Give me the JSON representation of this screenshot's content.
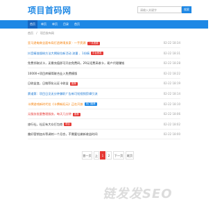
{
  "header": {
    "logo": "项目首码网",
    "search_placeholder": "请输入关键字",
    "search_button": "搜索"
  },
  "nav": [
    "首页",
    "单页",
    "单页",
    "目录",
    "首页"
  ],
  "breadcrumb": [
    "首页",
    "项目发布网"
  ],
  "rows": [
    {
      "title": "亚马逊电商全面布局打造跨境卖家 · 一手资源",
      "color": "#f57c00",
      "badge": "一手资源",
      "badge_color": "#e53935",
      "date": "02-22 18:34"
    },
    {
      "title": "抖音精准搜粉方法大揭秘拉新活动 流量 、1份搞",
      "color": "#1976d2",
      "badge": "平台首发",
      "badge_color": "#e53935",
      "date": "02-22 18:31"
    },
    {
      "title": "免费领取试卡，无需充值即可开启免费码，29元话费高收卡，易户代理赚钱",
      "color": "#333333",
      "badge": "",
      "badge_color": "",
      "date": "02-22 18:28"
    },
    {
      "title": "10000+项目库精简联合业入免费模版",
      "color": "#333333",
      "badge": "",
      "badge_color": "",
      "date": "02-22 18:22"
    },
    {
      "title": "日收益变，日推荐化认证卡收益",
      "color": "#333333",
      "badge": "推荐",
      "badge_color": "#e53935",
      "date": "02-22 18:19"
    },
    {
      "title": "赛道第：项目日见无分钟兼职广告新可短视频剪辑引流",
      "color": "#1976d2",
      "badge": "",
      "badge_color": "",
      "date": "02-22 18:14"
    },
    {
      "title": "卡牌游戏新时代拉《卡牌新纪元》正在开放",
      "color": "#f57c00",
      "badge": "热门推荐",
      "badge_color": "#1e88e5",
      "date": "02-22 18:10"
    },
    {
      "title": "元服务批量整理服务，每天几分钟",
      "color": "#e53935",
      "badge": "推荐",
      "badge_color": "#e53935",
      "date": "02-22 18:06"
    },
    {
      "title": "旅行社，社区有大众打包商",
      "color": "#333333",
      "badge": "项目",
      "badge_color": "#e53935",
      "date": "02-22 18:02"
    },
    {
      "title": "趣好营销加众等调剂一个月合，不需要社做新收益时间",
      "color": "#333333",
      "badge": "",
      "badge_color": "",
      "date": "02-22 18:00"
    }
  ],
  "pager": {
    "first": "首一页",
    "prev": "上",
    "page1": "1",
    "page2": "2",
    "next": "下一页",
    "last": "尾页"
  },
  "watermark": "链发发SEO"
}
